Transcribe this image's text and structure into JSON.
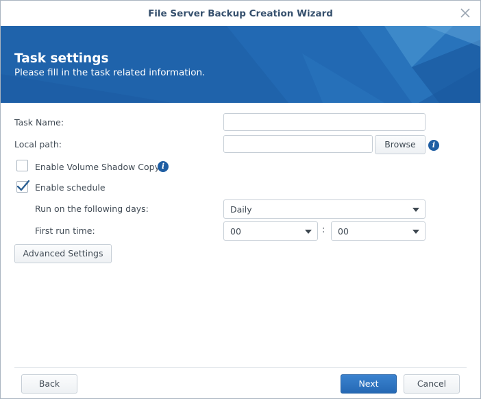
{
  "window": {
    "title": "File Server Backup Creation Wizard"
  },
  "banner": {
    "title": "Task settings",
    "subtitle": "Please fill in the task related information.",
    "accent_color": "#1e62aa"
  },
  "form": {
    "task_name": {
      "label": "Task Name:",
      "value": "",
      "placeholder": ""
    },
    "local_path": {
      "label": "Local path:",
      "value": "",
      "placeholder": "",
      "browse_label": "Browse",
      "info_icon": "info-icon"
    },
    "volume_shadow_copy": {
      "label": "Enable Volume Shadow Copy",
      "checked": false,
      "info_icon": "info-icon"
    },
    "schedule": {
      "label": "Enable schedule",
      "checked": true
    },
    "run_days": {
      "label": "Run on the following days:",
      "selected": "Daily"
    },
    "first_run_time": {
      "label": "First run time:",
      "hour": "00",
      "separator": ":",
      "minute": "00"
    },
    "advanced_label": "Advanced Settings"
  },
  "footer": {
    "back_label": "Back",
    "next_label": "Next",
    "cancel_label": "Cancel"
  }
}
